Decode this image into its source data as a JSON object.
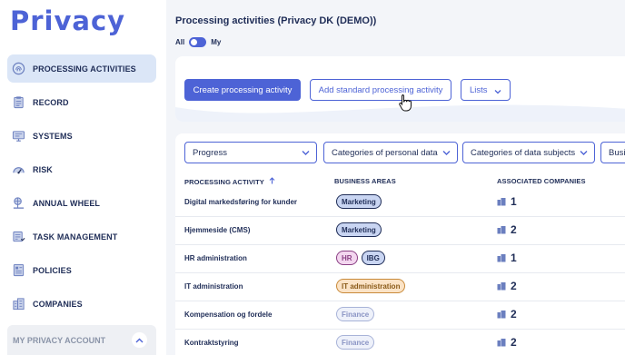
{
  "app": {
    "logo": "Privacy"
  },
  "sidebar": {
    "items": [
      {
        "label": "PROCESSING ACTIVITIES",
        "icon": "fingerprint-icon",
        "active": true
      },
      {
        "label": "RECORD",
        "icon": "clipboard-icon",
        "active": false
      },
      {
        "label": "SYSTEMS",
        "icon": "monitor-icon",
        "active": false
      },
      {
        "label": "RISK",
        "icon": "gauge-icon",
        "active": false
      },
      {
        "label": "ANNUAL WHEEL",
        "icon": "wheel-icon",
        "active": false
      },
      {
        "label": "TASK MANAGEMENT",
        "icon": "tasks-icon",
        "active": false
      },
      {
        "label": "POLICIES",
        "icon": "policy-icon",
        "active": false
      },
      {
        "label": "COMPANIES",
        "icon": "building-icon",
        "active": false
      }
    ],
    "account": {
      "label": "MY PRIVACY ACCOUNT",
      "icon": "chevron-up-icon"
    }
  },
  "header": {
    "title": "Processing activities (Privacy DK (DEMO))",
    "toggle": {
      "left_label": "All",
      "right_label": "My",
      "state": "all"
    }
  },
  "actions": {
    "create_label": "Create processing activity",
    "add_standard_label": "Add standard processing activity",
    "lists_label": "Lists"
  },
  "filters": [
    {
      "label": "Progress"
    },
    {
      "label": "Categories of personal data"
    },
    {
      "label": "Categories of data subjects"
    },
    {
      "label": "Busi"
    }
  ],
  "table": {
    "columns": [
      "PROCESSING ACTIVITY",
      "BUSINESS AREAS",
      "ASSOCIATED COMPANIES"
    ],
    "sort": {
      "column": "PROCESSING ACTIVITY",
      "direction": "ascending"
    },
    "rows": [
      {
        "name": "Digital markedsføring for kunder",
        "areas": [
          {
            "label": "Marketing",
            "style": "marketing"
          }
        ],
        "companies": "1"
      },
      {
        "name": "Hjemmeside (CMS)",
        "areas": [
          {
            "label": "Marketing",
            "style": "marketing"
          }
        ],
        "companies": "2"
      },
      {
        "name": "HR administration",
        "areas": [
          {
            "label": "HR",
            "style": "hr"
          },
          {
            "label": "IBG",
            "style": "ibg"
          }
        ],
        "companies": "1"
      },
      {
        "name": "IT administration",
        "areas": [
          {
            "label": "IT administration",
            "style": "it"
          }
        ],
        "companies": "2"
      },
      {
        "name": "Kompensation og fordele",
        "areas": [
          {
            "label": "Finance",
            "style": "finance"
          }
        ],
        "companies": "2"
      },
      {
        "name": "Kontraktstyring",
        "areas": [
          {
            "label": "Finance",
            "style": "finance"
          }
        ],
        "companies": "2"
      }
    ]
  },
  "colors": {
    "accent": "#4d63d6",
    "text": "#1f2d57",
    "active_nav": "#dbe6f7",
    "background": "#f3f5f9"
  }
}
